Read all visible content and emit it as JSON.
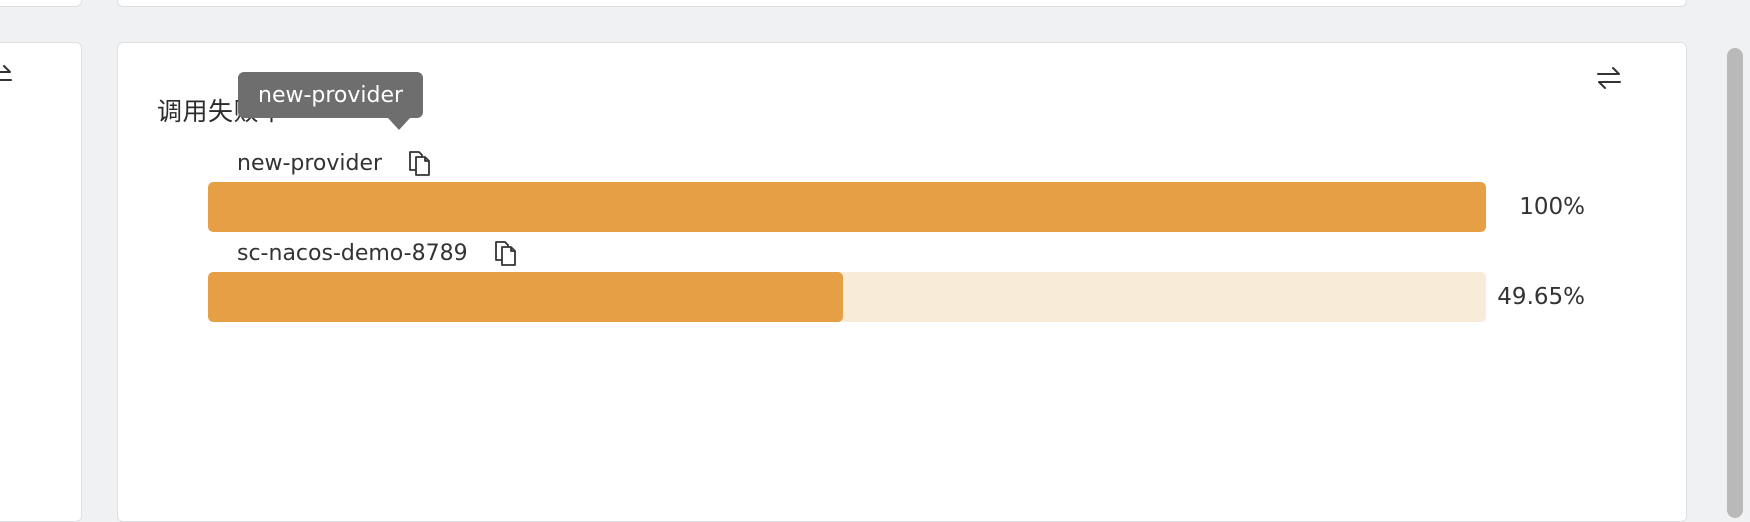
{
  "panel": {
    "title": "调用失败率",
    "rows": [
      {
        "name": "new-provider",
        "percent_label": "100%",
        "fill_fraction": 1.0
      },
      {
        "name": "sc-nacos-demo-8789",
        "percent_label": "49.65%",
        "fill_fraction": 0.4965
      }
    ],
    "tooltip": "new-provider"
  },
  "icons": {
    "swap": "swap-arrows-icon",
    "copy": "copy-icon"
  },
  "colors": {
    "bar_fill": "#e69f45",
    "bar_track": "#f8ecd8",
    "tooltip_bg": "#6e6e6e"
  }
}
